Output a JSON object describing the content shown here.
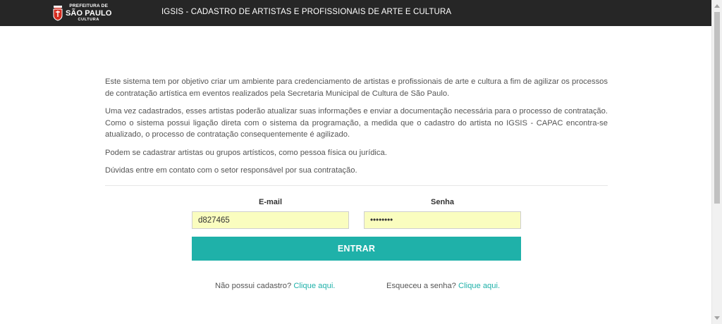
{
  "header": {
    "logo": {
      "line1": "PREFEITURA DE",
      "line2": "SÃO PAULO",
      "line3": "CULTURA"
    },
    "title": "IGSIS - CADASTRO DE ARTISTAS E PROFISSIONAIS DE ARTE E CULTURA"
  },
  "intro": {
    "paragraphs": [
      "Este sistema tem por objetivo criar um ambiente para credenciamento de artistas e profissionais de arte e cultura a fim de agilizar os processos de contratação artística em eventos realizados pela Secretaria Municipal de Cultura de São Paulo.",
      "Uma vez cadastrados, esses artistas poderão atualizar suas informações e enviar a documentação necessária para o processo de contratação. Como o sistema possui ligação direta com o sistema da programação, a medida que o cadastro do artista no IGSIS - CAPAC encontra-se atualizado, o processo de contratação consequentemente é agilizado.",
      "Podem se cadastrar artistas ou grupos artísticos, como pessoa física ou jurídica.",
      "Dúvidas entre em contato com o setor responsável por sua contratação."
    ]
  },
  "login": {
    "email_label": "E-mail",
    "email_value": "d827465",
    "password_label": "Senha",
    "password_value": "••••••••",
    "submit_label": "ENTRAR"
  },
  "footer": {
    "register_text": "Não possui cadastro?",
    "register_link": "Clique aqui.",
    "forgot_text": "Esqueceu a senha?",
    "forgot_link": "Clique aqui."
  },
  "colors": {
    "header_bg": "#262626",
    "accent": "#1fb1a9",
    "input_bg": "#fafdbf"
  }
}
